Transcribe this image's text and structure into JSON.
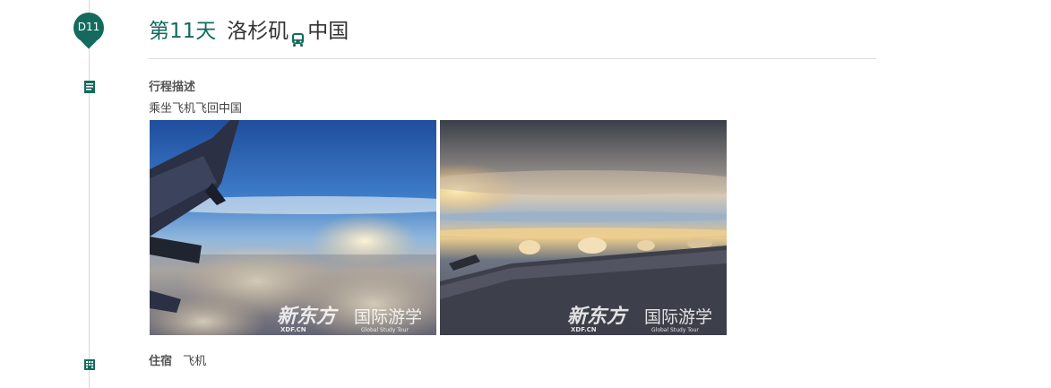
{
  "day": {
    "badge": "D11",
    "number_label": "第11天",
    "route_from": "洛杉矶",
    "transport_icon": "bus-icon",
    "route_to": "中国"
  },
  "itinerary": {
    "heading": "行程描述",
    "text": "乘坐飞机飞回中国"
  },
  "photos": [
    {
      "name": "wing-over-clouds-photo",
      "watermark_brand": "新东方",
      "watermark_sub": "XDF.CN",
      "watermark_title": "国际游学",
      "watermark_tag": "Global Study Tour"
    },
    {
      "name": "sunset-wing-photo",
      "watermark_brand": "新东方",
      "watermark_sub": "XDF.CN",
      "watermark_title": "国际游学",
      "watermark_tag": "Global Study Tour"
    }
  ],
  "accommodation": {
    "label": "住宿",
    "value": "飞机"
  },
  "colors": {
    "accent": "#146b5d",
    "divider": "#dcdcdc"
  }
}
